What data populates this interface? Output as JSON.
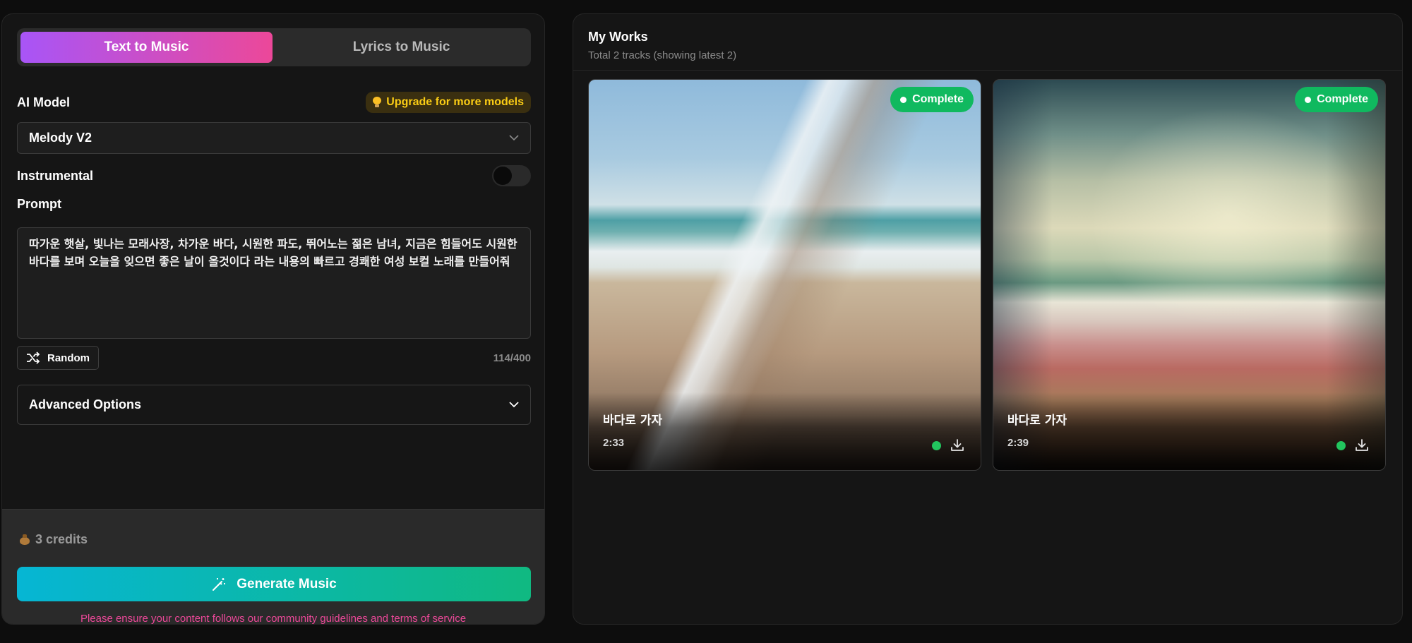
{
  "mode_tabs": [
    {
      "label": "Text to Music",
      "active": true
    },
    {
      "label": "Lyrics to Music",
      "active": false
    }
  ],
  "model": {
    "label": "AI Model",
    "upgrade_text": "Upgrade for more models",
    "selected": "Melody V2"
  },
  "instrumental": {
    "label": "Instrumental",
    "enabled": false
  },
  "prompt": {
    "label": "Prompt",
    "value": "따가운 햇살, 빛나는 모래사장, 차가운 바다, 시원한 파도, 뛰어노는 젊은 남녀, 지금은 힘들어도 시원한 바다를 보며 오늘을 잊으면 좋은 날이 올것이다 라는 내용의 빠르고 경쾌한 여성 보컬 노래를 만들어줘",
    "random_label": "Random",
    "char_count": "114/400"
  },
  "advanced_options": {
    "label": "Advanced Options"
  },
  "footer": {
    "credits": "3 credits",
    "generate_label": "Generate Music",
    "disclaimer": "Please ensure your content follows our community guidelines and terms of service"
  },
  "works": {
    "title": "My Works",
    "subtitle": "Total 2 tracks (showing latest 2)",
    "tracks": [
      {
        "title": "바다로 가자",
        "duration": "2:33",
        "status": "Complete"
      },
      {
        "title": "바다로 가자",
        "duration": "2:39",
        "status": "Complete"
      }
    ]
  },
  "colors": {
    "tab_gradient_start": "#a855f7",
    "tab_gradient_end": "#ec4899",
    "generate_gradient_start": "#06b6d4",
    "generate_gradient_end": "#10b981",
    "status_green": "#10b95f",
    "upgrade_yellow": "#facc15",
    "disclaimer_pink": "#ec4899"
  },
  "icons": {
    "upgrade": "lightbulb-icon",
    "select": "chevron-down-icon",
    "random": "shuffle-icon",
    "advanced": "chevron-down-icon",
    "credits": "moneybag-icon",
    "generate": "magic-wand-icon",
    "download": "download-icon"
  }
}
